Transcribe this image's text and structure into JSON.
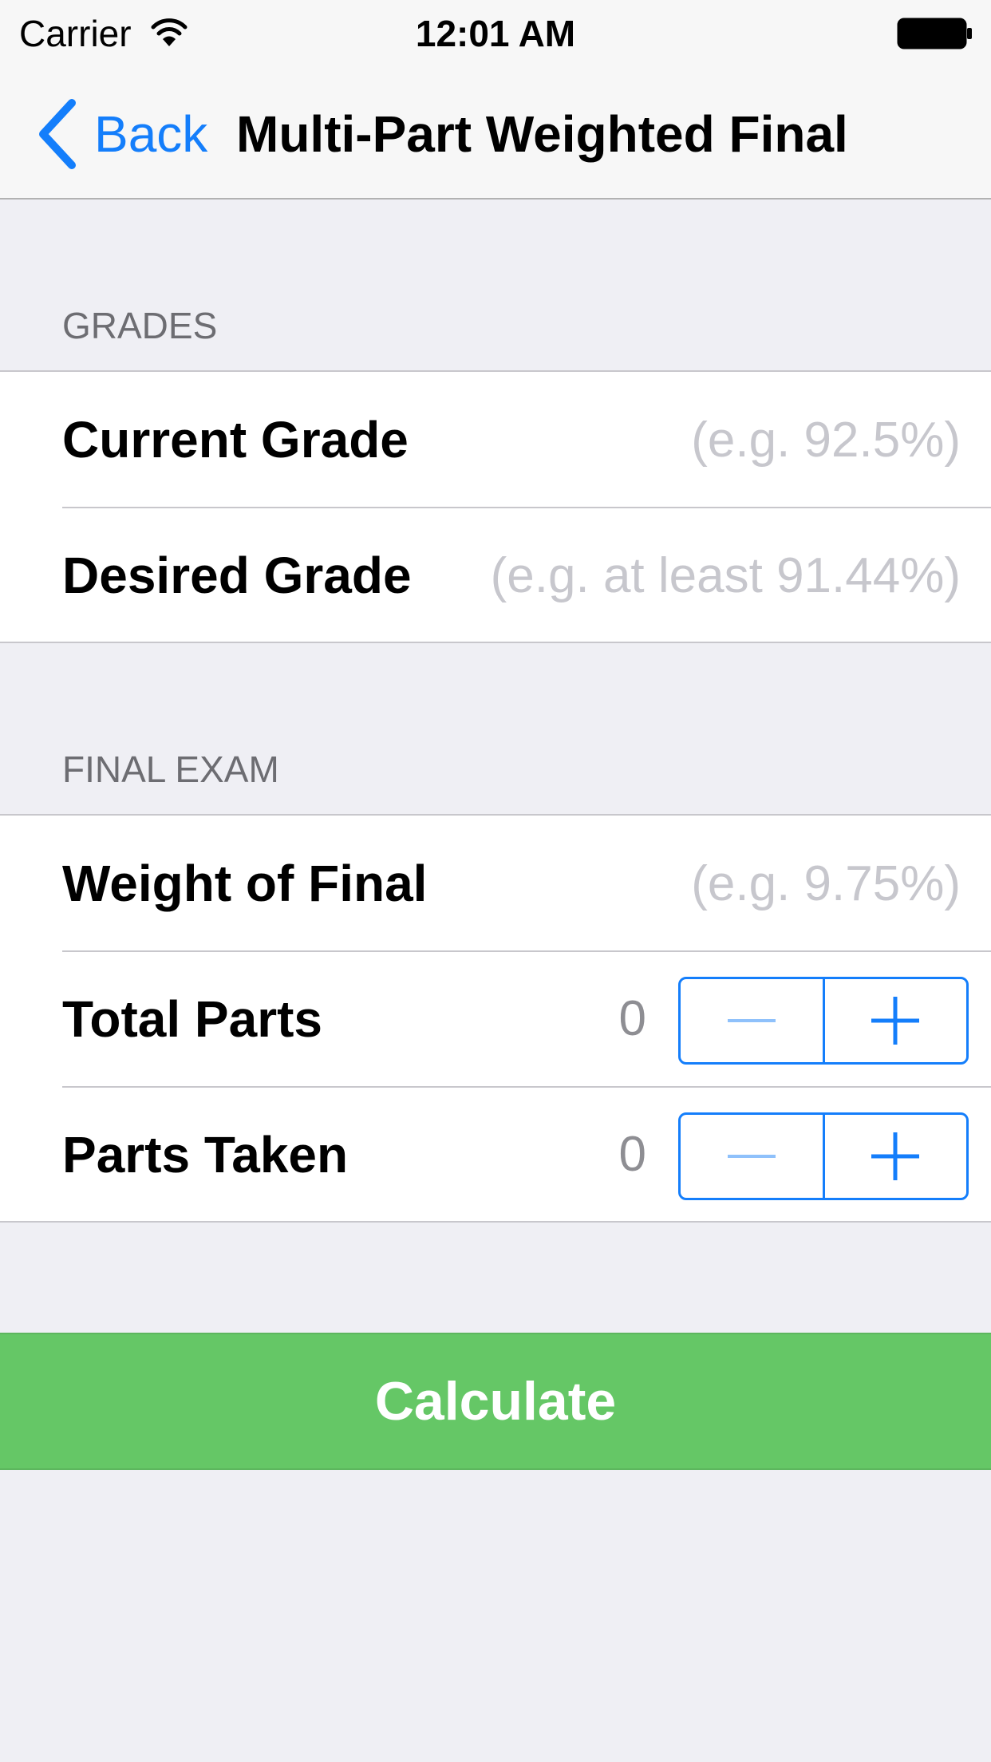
{
  "status_bar": {
    "carrier": "Carrier",
    "time": "12:01 AM",
    "wifi_icon": "wifi-icon",
    "battery_icon": "battery-icon"
  },
  "nav": {
    "back_label": "Back",
    "back_icon": "chevron-left-icon",
    "title": "Multi-Part Weighted Final"
  },
  "sections": {
    "grades": {
      "header": "GRADES",
      "current_grade": {
        "label": "Current Grade",
        "placeholder": "(e.g. 92.5%)",
        "value": ""
      },
      "desired_grade": {
        "label": "Desired Grade",
        "placeholder": "(e.g. at least 91.44%)",
        "value": ""
      }
    },
    "final_exam": {
      "header": "FINAL EXAM",
      "weight_of_final": {
        "label": "Weight of Final",
        "placeholder": "(e.g. 9.75%)",
        "value": ""
      },
      "total_parts": {
        "label": "Total Parts",
        "value": "0"
      },
      "parts_taken": {
        "label": "Parts Taken",
        "value": "0"
      }
    }
  },
  "calculate": {
    "label": "Calculate"
  },
  "colors": {
    "accent": "#147efb",
    "calculate_bg": "#65c766",
    "background": "#efeff4",
    "placeholder": "#c7c7cd"
  }
}
